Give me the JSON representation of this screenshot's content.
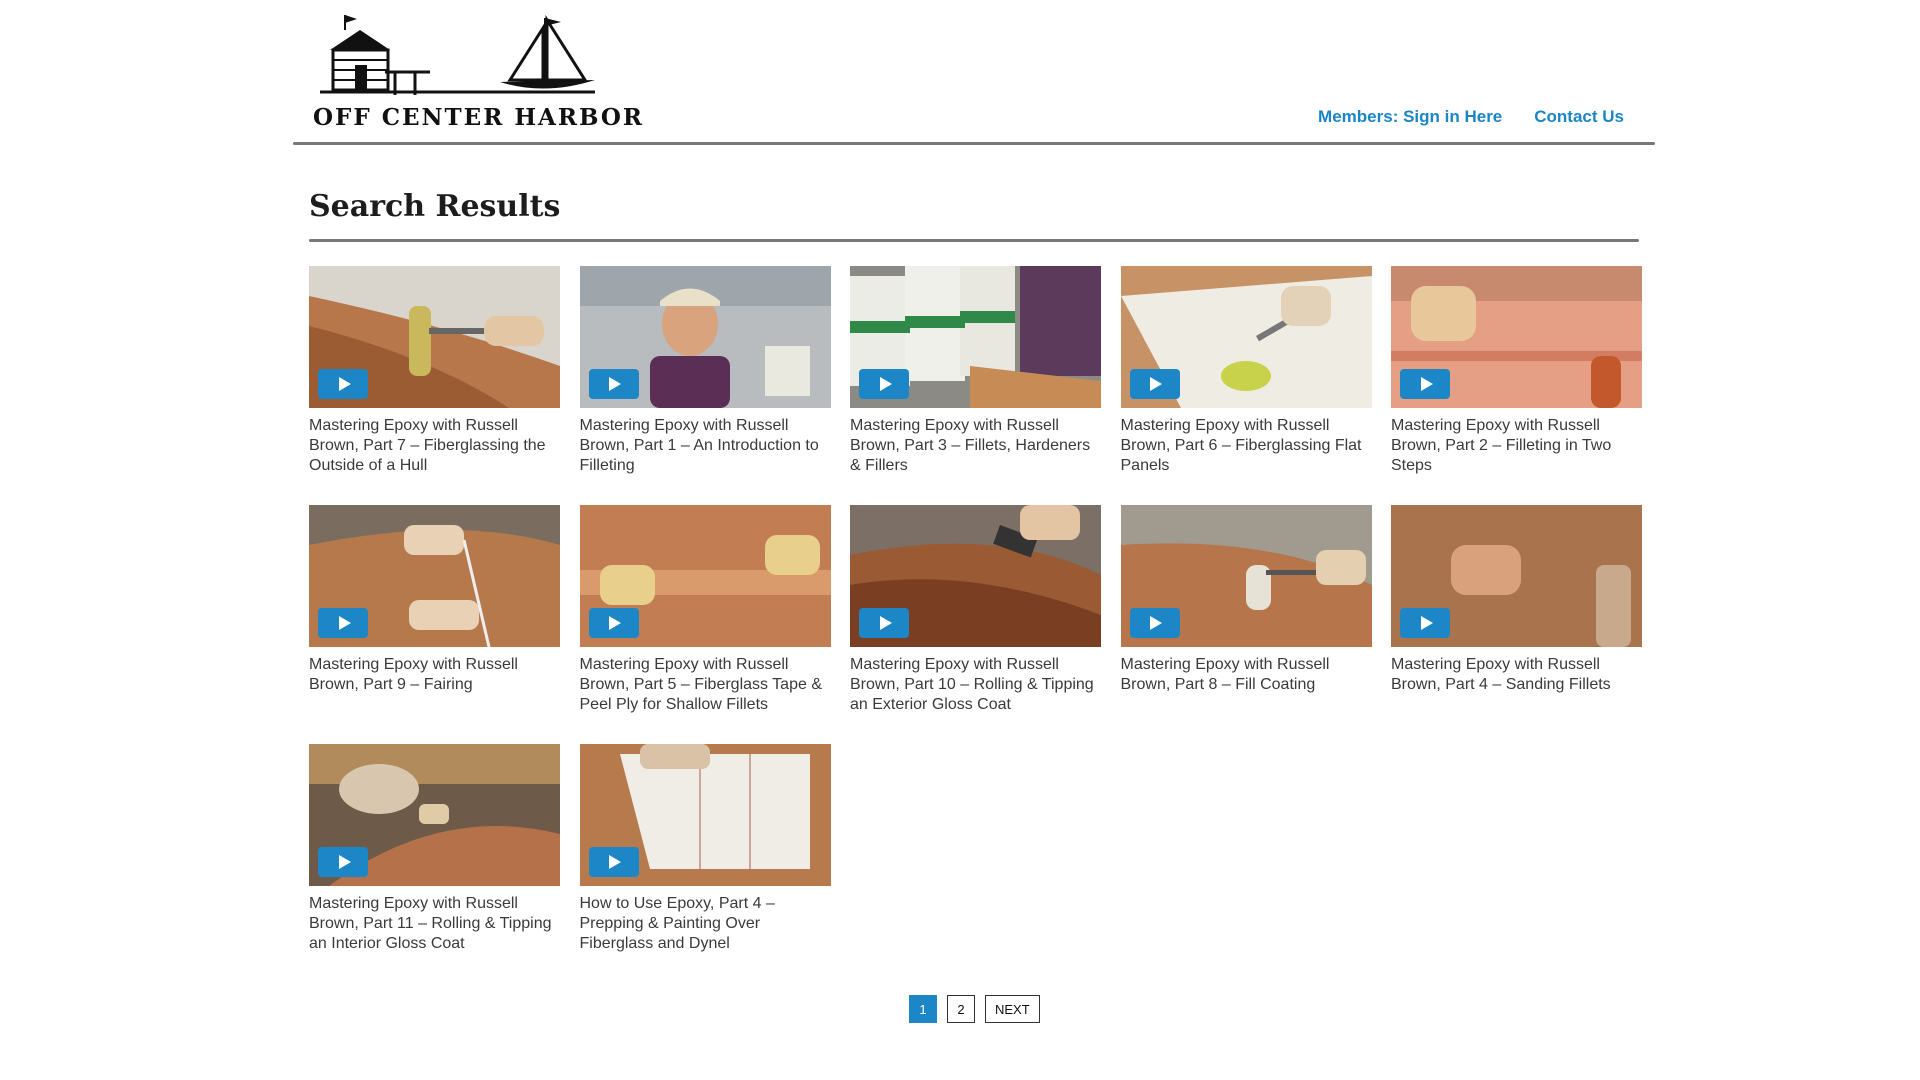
{
  "brand": {
    "name": "OFF CENTER HARBOR"
  },
  "nav": {
    "sign_in": "Members: Sign in Here",
    "contact": "Contact Us"
  },
  "page": {
    "title": "Search Results"
  },
  "colors": {
    "accent": "#1c86c7",
    "link": "#1b86c5"
  },
  "results": [
    {
      "title": "Mastering Epoxy with Russell Brown, Part 7 – Fiberglassing the Outside of a Hull",
      "play_icon": "play-icon"
    },
    {
      "title": "Mastering Epoxy with Russell Brown, Part 1 – An Introduction to Filleting",
      "play_icon": "play-icon"
    },
    {
      "title": "Mastering Epoxy with Russell Brown, Part 3 – Fillets, Hardeners & Fillers",
      "play_icon": "play-icon"
    },
    {
      "title": "Mastering Epoxy with Russell Brown, Part 6 – Fiberglassing Flat Panels",
      "play_icon": "play-icon"
    },
    {
      "title": "Mastering Epoxy with Russell Brown, Part 2 – Filleting in Two Steps",
      "play_icon": "play-icon"
    },
    {
      "title": "Mastering Epoxy with Russell Brown, Part 9 – Fairing",
      "play_icon": "play-icon"
    },
    {
      "title": "Mastering Epoxy with Russell Brown, Part 5 – Fiberglass Tape & Peel Ply for Shallow Fillets",
      "play_icon": "play-icon"
    },
    {
      "title": "Mastering Epoxy with Russell Brown, Part 10 – Rolling & Tipping an Exterior Gloss Coat",
      "play_icon": "play-icon"
    },
    {
      "title": "Mastering Epoxy with Russell Brown, Part 8 – Fill Coating",
      "play_icon": "play-icon"
    },
    {
      "title": "Mastering Epoxy with Russell Brown, Part 4 – Sanding Fillets",
      "play_icon": "play-icon"
    },
    {
      "title": "Mastering Epoxy with Russell Brown, Part 11 – Rolling & Tipping an Interior Gloss Coat",
      "play_icon": "play-icon"
    },
    {
      "title": "How to Use Epoxy, Part 4 – Prepping & Painting Over Fiberglass and Dynel",
      "play_icon": "play-icon"
    }
  ],
  "pagination": {
    "current": "1",
    "page2": "2",
    "next": "NEXT"
  }
}
